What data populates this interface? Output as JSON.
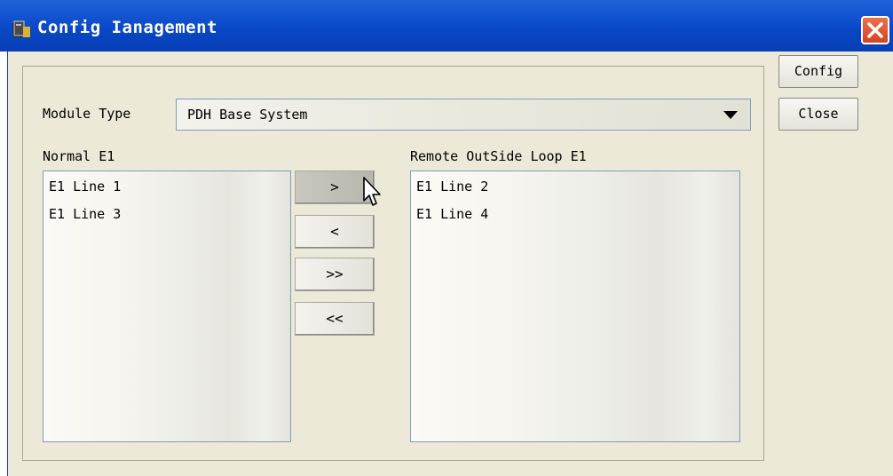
{
  "window": {
    "title": "Config Ianagement",
    "title_icon": "app-icon",
    "close_icon": "close-icon"
  },
  "module_type": {
    "label": "Module Type",
    "selected": "PDH Base System"
  },
  "normal_list": {
    "label": "Normal E1",
    "items": [
      "E1 Line 1",
      "E1 Line 3"
    ]
  },
  "remote_list": {
    "label": "Remote OutSide Loop E1",
    "items": [
      "E1 Line 2",
      "E1 Line 4"
    ]
  },
  "transfer_buttons": {
    "move_right": ">",
    "move_left": "<",
    "move_all_right": ">>",
    "move_all_left": "<<"
  },
  "side_buttons": {
    "config": "Config",
    "close": "Close"
  },
  "colors": {
    "titlebar": "#0a48c8",
    "client_bg": "#ece9d8",
    "close_button": "#e05a35"
  }
}
